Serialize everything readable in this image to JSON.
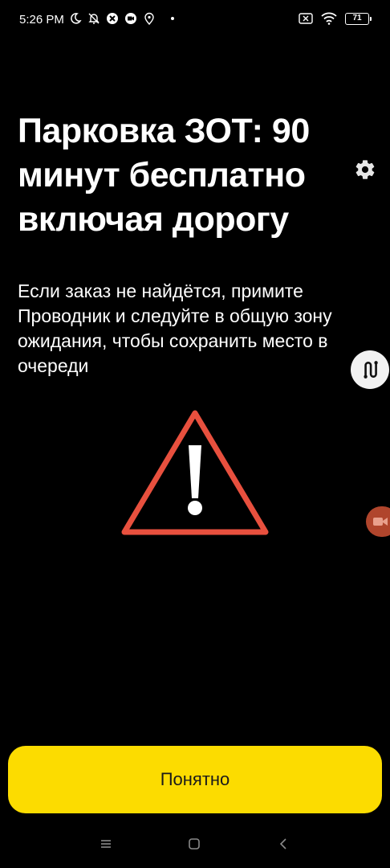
{
  "status_bar": {
    "time": "5:26 PM",
    "battery_level": "71",
    "icons_left": [
      "moon-icon",
      "bell-off-icon",
      "app-icon",
      "screen-record-icon",
      "location-icon",
      "dot-icon"
    ],
    "icons_right": [
      "sim-disabled-icon",
      "wifi-icon",
      "battery-icon"
    ]
  },
  "main": {
    "title": "Парковка ЗОТ: 90 минут бесплатно включая дорогу",
    "description": "Если заказ не найдётся, примите Проводник и следуйте в общую зону ожидания, чтобы сохранить место в очереди",
    "icons": [
      "gear-icon",
      "route-icon",
      "warning-triangle-icon",
      "camera-icon"
    ]
  },
  "ok_button": {
    "label": "Понятно"
  },
  "nav_bar": {
    "items": [
      "menu-icon",
      "home-icon",
      "back-icon"
    ]
  },
  "colors": {
    "background": "#000000",
    "accent_yellow": "#fcdc00",
    "warning_red": "#e8503e",
    "text": "#ffffff"
  }
}
